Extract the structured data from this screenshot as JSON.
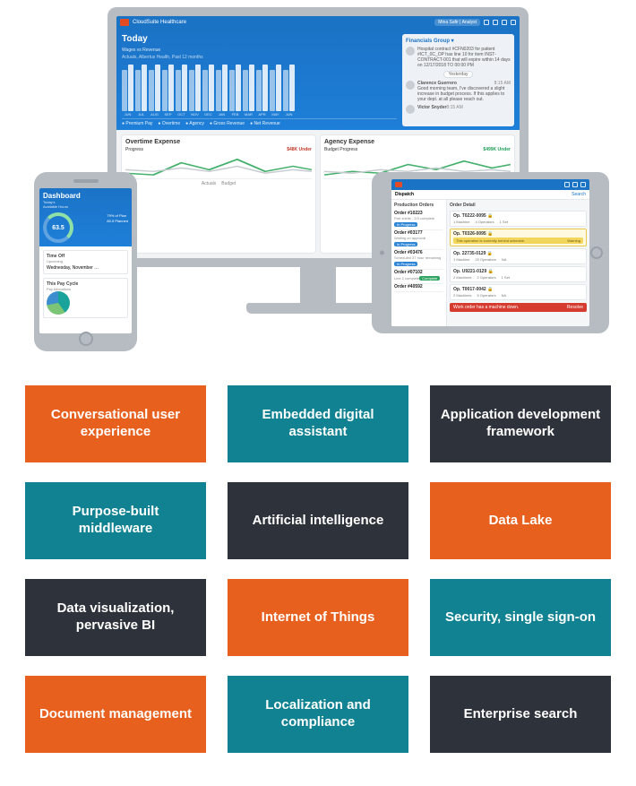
{
  "monitor": {
    "app_title": "CloudSuite Healthcare",
    "user_label": "Mina Safir | Analyst",
    "today": "Today",
    "hero_title": "Wages vs Revenue",
    "hero_subtitle": "Actuals, Albertus Health, Past 12 months",
    "months": [
      "JUN",
      "JUL",
      "AUG",
      "SEP",
      "OCT",
      "NOV",
      "DEC",
      "JAN",
      "FEB",
      "MAR",
      "APR",
      "MAY",
      "JUN"
    ],
    "legend": [
      "Premium Pay",
      "Overtime",
      "Agency",
      "Gross Revenue",
      "Net Revenue"
    ],
    "feed_title": "Financials Group ▾",
    "feed_msg1": "Hospital contract #CFN0203 for patient #ICT_0C_OP has line 10 for item INST-CONTRACT-001 that will expire within 14 days on 12/17/2018 TO 00:00 PM",
    "feed_chip": "Yesterday",
    "feed_name2": "Clarence Guerrero",
    "feed_time2": "8:15 AM",
    "feed_msg2": "Good morning team, I've discovered a slight increase in budget process. If this applies to your dept. at all please reach out.",
    "feed_name3": "Victor Snyder",
    "feed_time3": "8:15 AM",
    "card1_title": "Overtime Expense",
    "card1_label": "Progress",
    "card1_value": "$48K Under",
    "card2_title": "Agency Expense",
    "card2_label": "Budget Progress",
    "card2_value": "$499K Under",
    "card_legend_a": "Actuals",
    "card_legend_b": "Budget"
  },
  "phone": {
    "title": "Dashboard",
    "sub1": "Today's",
    "sub2": "Available Hours",
    "donut_value": "63.5",
    "donut_unit": "Hours",
    "kpi1": "79% of Plan",
    "kpi2": "80.5 Planned",
    "section1": "Time Off",
    "section1_sub": "Upcoming",
    "section1_item": "Wednesday, November …",
    "section2": "This Pay Cycle",
    "section2_sub": "Pay Allocations"
  },
  "tablet": {
    "title": "Dispatch",
    "search_label": "Search",
    "left_title": "Production Orders",
    "right_title": "Order Detail",
    "orders": [
      {
        "no": "Order #10223",
        "sub": "Part shells - 2/3 complete",
        "status": "In Progress",
        "statusClass": "blue"
      },
      {
        "no": "Order #03177",
        "sub": "Waiting on approval",
        "status": "In Progress",
        "statusClass": "blue"
      },
      {
        "no": "Order #03476",
        "sub": "Scheduled 37 hour remaining",
        "status": "In Progress",
        "statusClass": "blue"
      },
      {
        "no": "Order #07102",
        "sub": "Line 2 complete",
        "status": "Complete",
        "statusClass": "green"
      },
      {
        "no": "Order #40592",
        "sub": "",
        "status": "",
        "statusClass": ""
      }
    ],
    "ops": [
      {
        "id": "Op. T0222-0095 🔒",
        "m1": "1 Machine",
        "m2": "4 Operators",
        "m3": "1 Set"
      },
      {
        "id": "Op. T0326-0095 🔒",
        "warn": true,
        "warn_text": "This operation is currently behind schedule.",
        "warn_badge": "Warning"
      },
      {
        "id": "Op. 22735-0129 🔒",
        "m1": "1 Machine",
        "m2": "20 Operators",
        "m3": "NA"
      },
      {
        "id": "Op. U9221-0129 🔒",
        "m1": "2 Machines",
        "m2": "2 Operators",
        "m3": "1 Set"
      },
      {
        "id": "Op. T0017-0042 🔒",
        "m1": "2 Machines",
        "m2": "5 Operators",
        "m3": "NA"
      }
    ],
    "alert_text": "Work order has a machine down.",
    "alert_action": "Resolve"
  },
  "tiles": [
    {
      "text": "Conversational user experience",
      "color": "orange"
    },
    {
      "text": "Embedded digital assistant",
      "color": "teal"
    },
    {
      "text": "Application development framework",
      "color": "dark"
    },
    {
      "text": "Purpose-built middleware",
      "color": "teal"
    },
    {
      "text": "Artificial intelligence",
      "color": "dark"
    },
    {
      "text": "Data Lake",
      "color": "orange"
    },
    {
      "text": "Data visualization, pervasive BI",
      "color": "dark"
    },
    {
      "text": "Internet of Things",
      "color": "orange"
    },
    {
      "text": "Security, single sign-on",
      "color": "teal"
    },
    {
      "text": "Document management",
      "color": "orange"
    },
    {
      "text": "Localization and compliance",
      "color": "teal"
    },
    {
      "text": "Enterprise search",
      "color": "dark"
    }
  ],
  "chart_data": {
    "type": "bar",
    "title": "Wages vs Revenue",
    "categories": [
      "JUN",
      "JUL",
      "AUG",
      "SEP",
      "OCT",
      "NOV",
      "DEC",
      "JAN",
      "FEB",
      "MAR",
      "APR",
      "MAY",
      "JUN"
    ],
    "series": [
      {
        "name": "Wages",
        "values": [
          50,
          50,
          50,
          50,
          50,
          50,
          50,
          50,
          50,
          50,
          50,
          50,
          50
        ]
      },
      {
        "name": "Revenue",
        "values": [
          55,
          55,
          55,
          55,
          55,
          55,
          55,
          55,
          55,
          55,
          55,
          55,
          55
        ]
      }
    ],
    "ylabel": "",
    "xlabel": "",
    "ylim": [
      0,
      60
    ]
  }
}
